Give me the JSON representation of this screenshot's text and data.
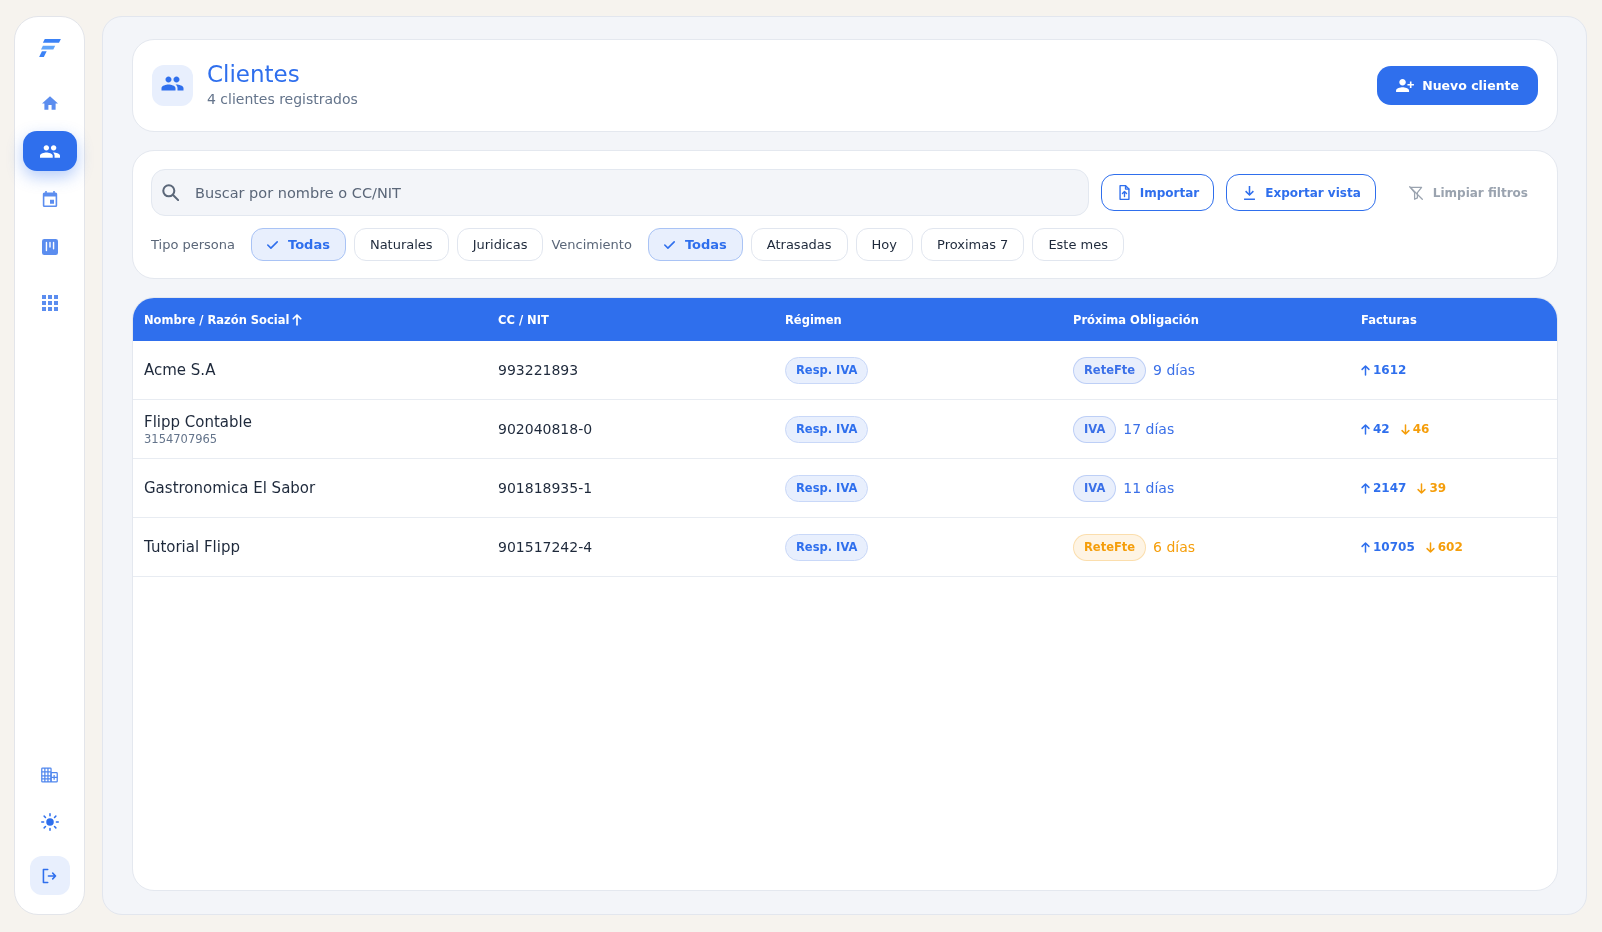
{
  "sidebar": {
    "nav": [
      {
        "selected": false
      },
      {
        "selected": true
      },
      {
        "selected": false
      },
      {
        "selected": false
      },
      {
        "selected": false
      }
    ]
  },
  "header": {
    "title": "Clientes",
    "subtitle": "4 clientes registrados",
    "action": "Nuevo cliente"
  },
  "filters": {
    "search": {
      "placeholder": "Buscar por nombre o CC/NIT"
    },
    "buttons": [
      {
        "label": "Importar",
        "kind": "import",
        "disabled": false
      },
      {
        "label": "Exportar vista",
        "kind": "export",
        "disabled": false
      },
      {
        "label": "Limpiar filtros",
        "kind": "clear",
        "disabled": true
      }
    ],
    "groups": [
      {
        "label": "Tipo persona",
        "options": [
          {
            "label": "Todas",
            "selected": true
          },
          {
            "label": "Naturales",
            "selected": false
          },
          {
            "label": "Juridicas",
            "selected": false
          }
        ]
      },
      {
        "label": "Vencimiento",
        "options": [
          {
            "label": "Todas",
            "selected": true
          },
          {
            "label": "Atrasadas",
            "selected": false
          },
          {
            "label": "Hoy",
            "selected": false
          },
          {
            "label": "Proximas 7",
            "selected": false
          },
          {
            "label": "Este mes",
            "selected": false
          }
        ]
      }
    ]
  },
  "table": {
    "columns": [
      {
        "label": "Nombre / Razón Social",
        "sorted": true
      },
      {
        "label": "CC / NIT",
        "sorted": false
      },
      {
        "label": "Régimen",
        "sorted": false
      },
      {
        "label": "Próxima Obligación",
        "sorted": false
      },
      {
        "label": "Facturas",
        "sorted": false
      }
    ],
    "rows": [
      {
        "name": "Acme S.A",
        "nit": "993221893",
        "regime": "Resp. IVA",
        "obligation": {
          "tag": "ReteFte",
          "due": "9 días",
          "color": "#3b70e8"
        },
        "invoices": {
          "issued": "1612"
        }
      },
      {
        "name": "Flipp Contable",
        "detail": "3154707965",
        "nit": "902040818-0",
        "regime": "Resp. IVA",
        "obligation": {
          "tag": "IVA",
          "due": "17 días",
          "color": "#3b70e8"
        },
        "invoices": {
          "issued": "42",
          "received": "46"
        }
      },
      {
        "name": "Gastronomica El Sabor",
        "nit": "901818935-1",
        "regime": "Resp. IVA",
        "obligation": {
          "tag": "IVA",
          "due": "11 días",
          "color": "#3b70e8"
        },
        "invoices": {
          "issued": "2147",
          "received": "39"
        }
      },
      {
        "name": "Tutorial Flipp",
        "nit": "901517242-4",
        "regime": "Resp. IVA",
        "obligation": {
          "tag": "ReteFte",
          "due": "6 días",
          "color": "#f59e0b"
        },
        "invoices": {
          "issued": "10705",
          "received": "602"
        }
      }
    ]
  }
}
